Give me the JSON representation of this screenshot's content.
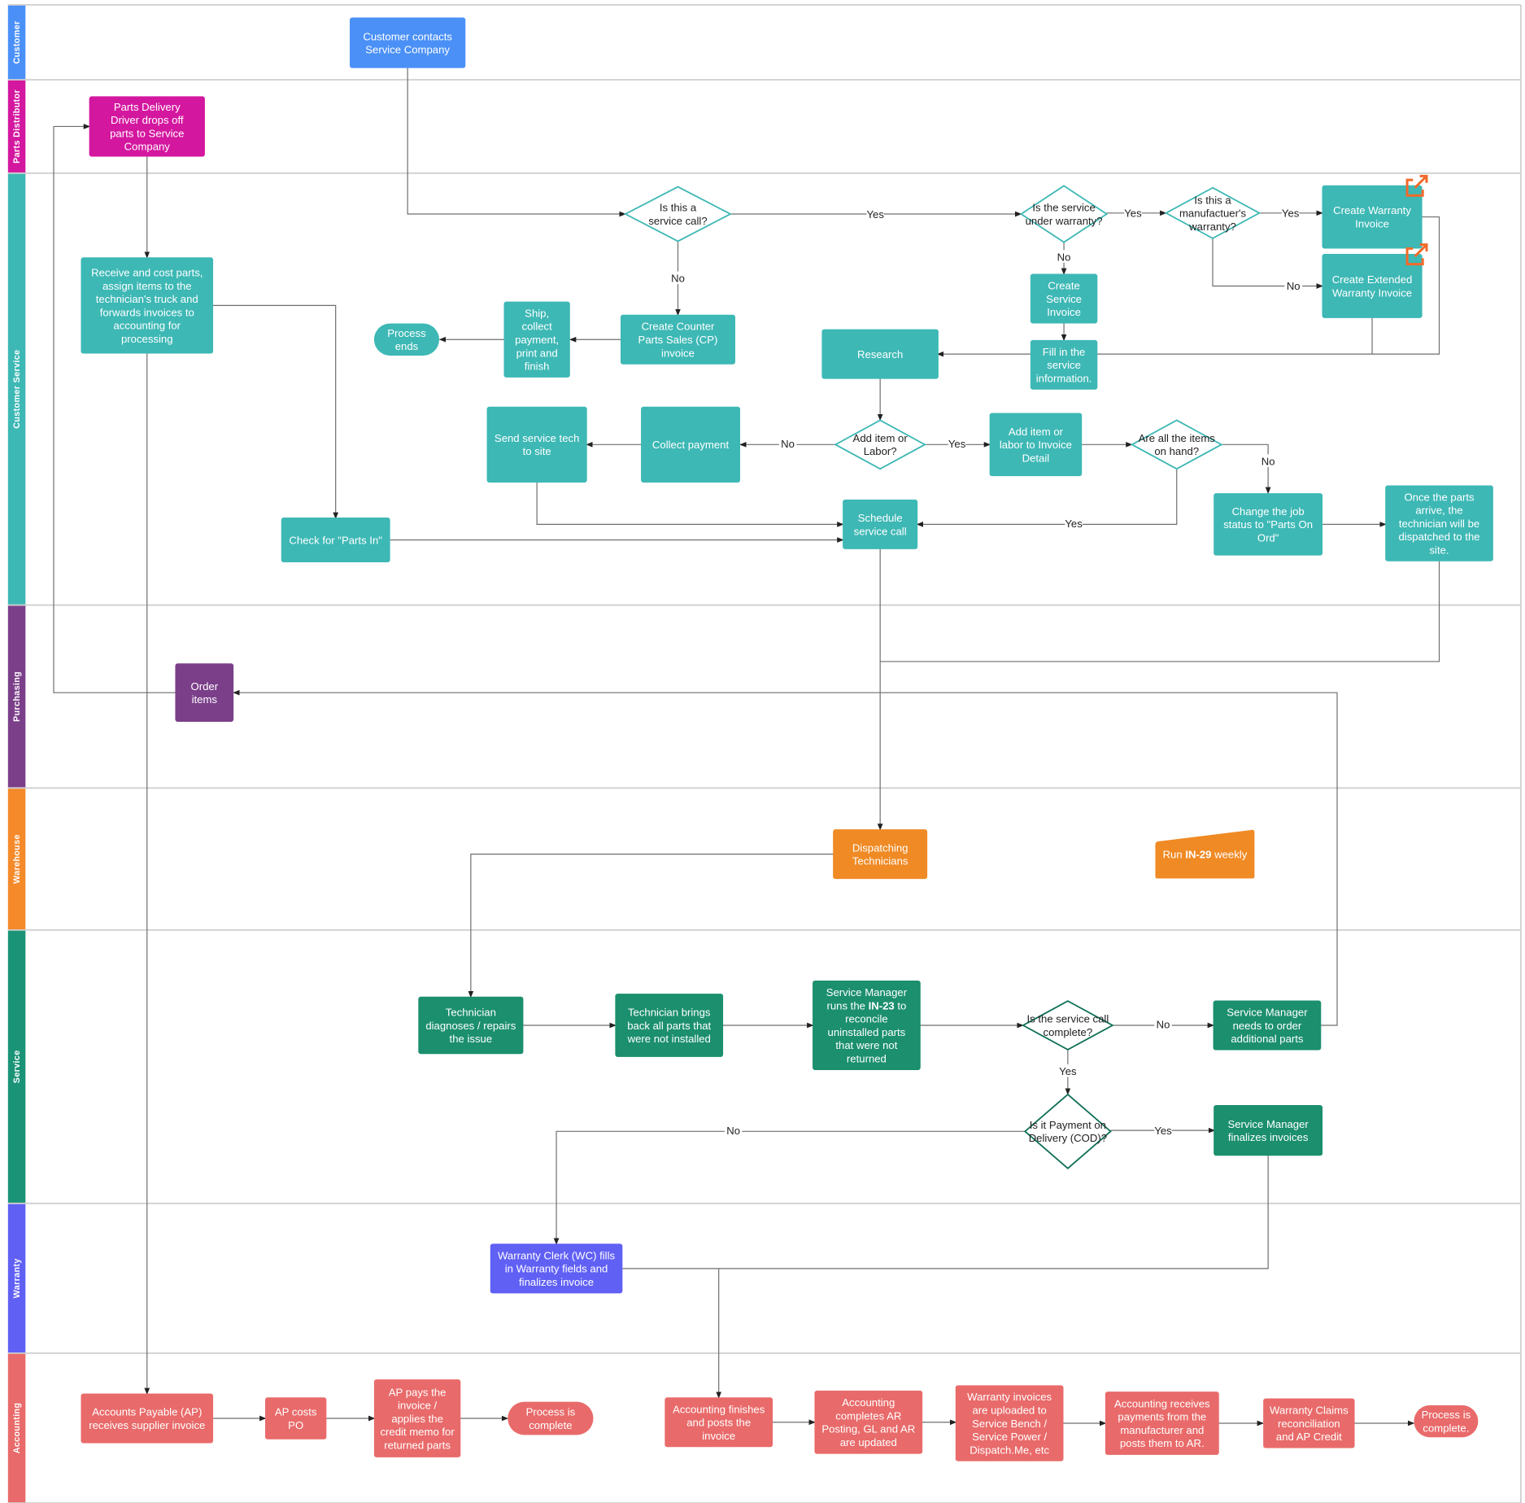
{
  "lanes": [
    {
      "name": "Customer",
      "color": "#4a90f7"
    },
    {
      "name": "Parts Distributor",
      "color": "#d4179f"
    },
    {
      "name": "Customer Service",
      "color": "#3db8b5"
    },
    {
      "name": "Purchasing",
      "color": "#7b3f8a"
    },
    {
      "name": "Warehouse",
      "color": "#f58a2a"
    },
    {
      "name": "Service",
      "color": "#1a9376"
    },
    {
      "name": "Warranty",
      "color": "#6060f5"
    },
    {
      "name": "Accounting",
      "color": "#e96a6a"
    }
  ],
  "colors": {
    "customer": "#4a90f7",
    "parts": "#d4179f",
    "cs": "#3db8b5",
    "purchasing": "#7b3f8a",
    "warehouse": "#f08a24",
    "service": "#1b8f6e",
    "service_stroke": "#0d6e55",
    "warranty": "#6060f5",
    "accounting": "#e96a6a",
    "link_icon": "#f26a2a"
  },
  "nodes": {
    "customer_contacts": [
      "Customer contacts",
      "Service Company"
    ],
    "parts_delivery": [
      "Parts Delivery",
      "Driver drops off",
      "parts to Service",
      "Company"
    ],
    "receive_cost": [
      "Receive and cost parts,",
      "assign items to the",
      "technician's truck and",
      "forwards invoices to",
      "accounting for",
      "processing"
    ],
    "service_call_q": [
      "Is this a",
      "service call?"
    ],
    "counter_parts": [
      "Create Counter",
      "Parts Sales (CP)",
      "invoice"
    ],
    "ship": [
      "Ship,",
      "collect",
      "payment,",
      "print and",
      "finish"
    ],
    "process_ends": [
      "Process",
      "ends"
    ],
    "warranty_q": [
      "Is the service",
      "under warranty?"
    ],
    "manufacturer_q": [
      "Is this a",
      "manufactuer's",
      "warranty?"
    ],
    "create_warranty": [
      "Create Warranty",
      "Invoice"
    ],
    "create_extended": [
      "Create Extended",
      "Warranty Invoice"
    ],
    "create_service": [
      "Create",
      "Service",
      "Invoice"
    ],
    "fill_service": [
      "Fill in the",
      "service",
      "information."
    ],
    "research": [
      "Research"
    ],
    "add_q": [
      "Add item or",
      "Labor?"
    ],
    "add_item": [
      "Add item or",
      "labor to Invoice",
      "Detail"
    ],
    "onhand_q": [
      "Are all the items",
      "on hand?"
    ],
    "collect_payment": [
      "Collect payment"
    ],
    "send_tech": [
      "Send service tech",
      "to site"
    ],
    "schedule": [
      "Schedule",
      "service call"
    ],
    "check_parts": [
      "Check for \"Parts In\""
    ],
    "change_status": [
      "Change the job",
      "status to \"Parts On",
      "Ord\""
    ],
    "once_parts": [
      "Once the parts",
      "arrive, the",
      "technician will be",
      "dispatched to the",
      "site."
    ],
    "order_items": [
      "Order",
      "items"
    ],
    "dispatching": [
      "Dispatching",
      "Technicians"
    ],
    "run_in29": [
      "Run IN-29 weekly"
    ],
    "technician_diag": [
      "Technician",
      "diagnoses / repairs",
      "the issue"
    ],
    "tech_brings": [
      "Technician brings",
      "back all parts that",
      "were not installed"
    ],
    "sm_runs": [
      "Service Manager",
      "runs the IN-23 to",
      "reconcile",
      "uninstalled parts",
      "that were not",
      "returned"
    ],
    "complete_q": [
      "Is the service call",
      "complete?"
    ],
    "sm_order": [
      "Service Manager",
      "needs to order",
      "additional parts"
    ],
    "cod_q": [
      "Is it Payment on",
      "Delivery (COD)?"
    ],
    "sm_finalizes": [
      "Service Manager",
      "finalizes invoices"
    ],
    "warranty_clerk": [
      "Warranty Clerk (WC) fills",
      "in Warranty fields and",
      "finalizes invoice"
    ],
    "ap_receives": [
      "Accounts Payable (AP)",
      "receives supplier invoice"
    ],
    "ap_costs": [
      "AP costs",
      "PO"
    ],
    "ap_pays": [
      "AP pays the",
      "invoice /",
      "applies the",
      "credit memo for",
      "returned parts"
    ],
    "process_complete1": [
      "Process is",
      "complete"
    ],
    "acct_finishes": [
      "Accounting finishes",
      "and posts the",
      "invoice"
    ],
    "acct_completes": [
      "Accounting",
      "completes AR",
      "Posting, GL and AR",
      "are updated"
    ],
    "warranty_uploaded": [
      "Warranty invoices",
      "are uploaded to",
      "Service Bench /",
      "Service Power /",
      "Dispatch.Me, etc"
    ],
    "acct_receives": [
      "Accounting receives",
      "payments from the",
      "manufacturer and",
      "posts them to AR."
    ],
    "claims": [
      "Warranty Claims",
      "reconciliation",
      "and AP Credit"
    ],
    "process_complete2": [
      "Process is",
      "complete."
    ]
  },
  "connectors": [
    {
      "from": "customer_contacts",
      "to": "service_call_q",
      "label": ""
    },
    {
      "from": "service_call_q",
      "to": "warranty_q",
      "label": "Yes"
    },
    {
      "from": "service_call_q",
      "to": "counter_parts",
      "label": "No"
    },
    {
      "from": "counter_parts",
      "to": "ship",
      "label": ""
    },
    {
      "from": "ship",
      "to": "process_ends",
      "label": ""
    },
    {
      "from": "warranty_q",
      "to": "manufacturer_q",
      "label": "Yes"
    },
    {
      "from": "manufacturer_q",
      "to": "create_warranty",
      "label": "Yes"
    },
    {
      "from": "manufacturer_q",
      "to": "create_extended",
      "label": "No"
    },
    {
      "from": "warranty_q",
      "to": "create_service",
      "label": "No"
    },
    {
      "from": "create_service",
      "to": "fill_service",
      "label": ""
    },
    {
      "from": "fill_service",
      "to": "research",
      "label": ""
    },
    {
      "from": "create_warranty",
      "to": "research",
      "label": ""
    },
    {
      "from": "create_extended",
      "to": "research",
      "label": ""
    },
    {
      "from": "research",
      "to": "add_q",
      "label": ""
    },
    {
      "from": "add_q",
      "to": "add_item",
      "label": "Yes"
    },
    {
      "from": "add_q",
      "to": "collect_payment",
      "label": "No"
    },
    {
      "from": "collect_payment",
      "to": "send_tech",
      "label": ""
    },
    {
      "from": "add_item",
      "to": "onhand_q",
      "label": ""
    },
    {
      "from": "onhand_q",
      "to": "change_status",
      "label": "No"
    },
    {
      "from": "onhand_q",
      "to": "schedule",
      "label": "Yes"
    },
    {
      "from": "send_tech",
      "to": "schedule",
      "label": ""
    },
    {
      "from": "check_parts",
      "to": "schedule",
      "label": ""
    },
    {
      "from": "change_status",
      "to": "once_parts",
      "label": ""
    },
    {
      "from": "once_parts",
      "to": "dispatching",
      "label": ""
    },
    {
      "from": "schedule",
      "to": "dispatching",
      "label": ""
    },
    {
      "from": "receive_cost",
      "to": "check_parts",
      "label": ""
    },
    {
      "from": "parts_delivery",
      "to": "receive_cost",
      "label": ""
    },
    {
      "from": "receive_cost",
      "to": "ap_receives",
      "label": ""
    },
    {
      "from": "order_items",
      "to": "parts_delivery",
      "label": ""
    },
    {
      "from": "sm_order",
      "to": "order_items",
      "label": ""
    },
    {
      "from": "dispatching",
      "to": "technician_diag",
      "label": ""
    },
    {
      "from": "technician_diag",
      "to": "tech_brings",
      "label": ""
    },
    {
      "from": "tech_brings",
      "to": "sm_runs",
      "label": ""
    },
    {
      "from": "sm_runs",
      "to": "complete_q",
      "label": ""
    },
    {
      "from": "complete_q",
      "to": "sm_order",
      "label": "No"
    },
    {
      "from": "complete_q",
      "to": "cod_q",
      "label": "Yes"
    },
    {
      "from": "cod_q",
      "to": "sm_finalizes",
      "label": "Yes"
    },
    {
      "from": "cod_q",
      "to": "warranty_clerk",
      "label": "No"
    },
    {
      "from": "sm_finalizes",
      "to": "acct_finishes",
      "label": ""
    },
    {
      "from": "warranty_clerk",
      "to": "acct_finishes",
      "label": ""
    },
    {
      "from": "ap_receives",
      "to": "ap_costs",
      "label": ""
    },
    {
      "from": "ap_costs",
      "to": "ap_pays",
      "label": ""
    },
    {
      "from": "ap_pays",
      "to": "process_complete1",
      "label": ""
    },
    {
      "from": "acct_finishes",
      "to": "acct_completes",
      "label": ""
    },
    {
      "from": "acct_completes",
      "to": "warranty_uploaded",
      "label": ""
    },
    {
      "from": "warranty_uploaded",
      "to": "acct_receives",
      "label": ""
    },
    {
      "from": "acct_receives",
      "to": "claims",
      "label": ""
    },
    {
      "from": "claims",
      "to": "process_complete2",
      "label": ""
    }
  ]
}
